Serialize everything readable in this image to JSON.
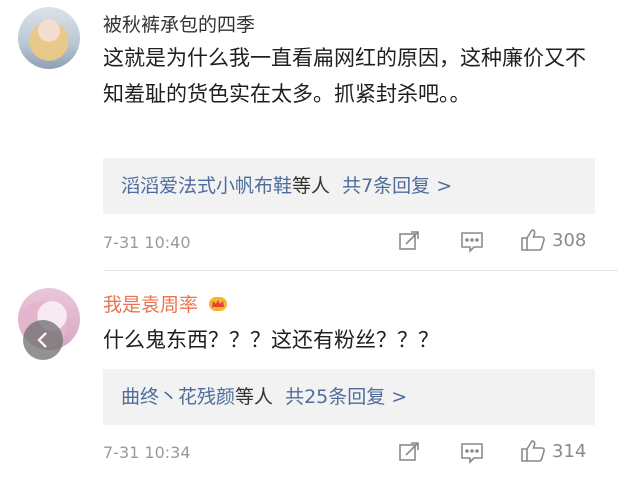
{
  "comments": [
    {
      "username": "被秋裤承包的四季",
      "text": "这就是为什么我一直看扁网红的原因，这种廉价又不知羞耻的货色实在太多。抓紧封杀吧。。",
      "reply_users": "滔滔爱法式小帆布鞋",
      "reply_suffix": "等人",
      "reply_count": "共7条回复 >",
      "time": "7-31 10:40",
      "likes": "308"
    },
    {
      "username": "我是袁周率",
      "text": "什么鬼东西？？？这还有粉丝？？？",
      "reply_users": "曲终丶花残颜",
      "reply_suffix": "等人",
      "reply_count": "共25条回复 >",
      "time": "7-31 10:34",
      "likes": "314"
    }
  ],
  "colors": {
    "link": "#4e6d9c",
    "vip_name": "#eb7350",
    "reply_bg": "#f2f2f2"
  },
  "icons": [
    "crown-icon",
    "share-icon",
    "comment-icon",
    "thumbs-up-icon",
    "chevron-left-icon"
  ]
}
